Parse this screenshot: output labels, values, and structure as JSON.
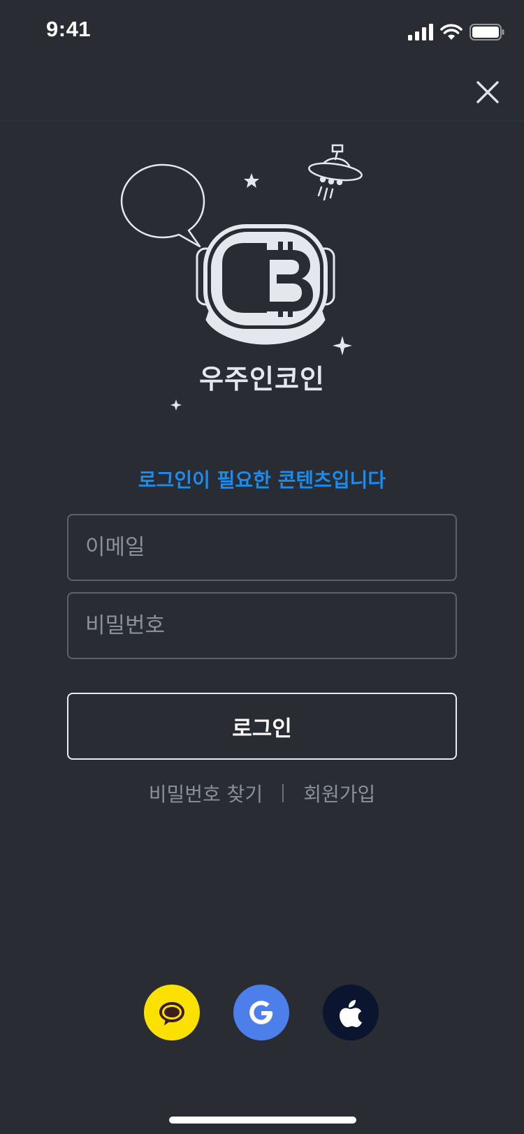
{
  "status_bar": {
    "time": "9:41"
  },
  "illustration": {
    "brand_name": "우주인코인"
  },
  "notice": "로그인이 필요한 콘텐츠입니다",
  "form": {
    "email_placeholder": "이메일",
    "password_placeholder": "비밀번호",
    "login_label": "로그인"
  },
  "links": {
    "find_password": "비밀번호 찾기",
    "signup": "회원가입"
  },
  "social": [
    {
      "icon": "kakao-talk-icon",
      "color": "#fae100"
    },
    {
      "icon": "google-icon",
      "color": "#4c7fe9"
    },
    {
      "icon": "apple-icon",
      "color": "#0b1530"
    }
  ],
  "colors": {
    "background": "#292d33",
    "accent": "#1a8cf0",
    "muted_text": "#8b8f96"
  }
}
